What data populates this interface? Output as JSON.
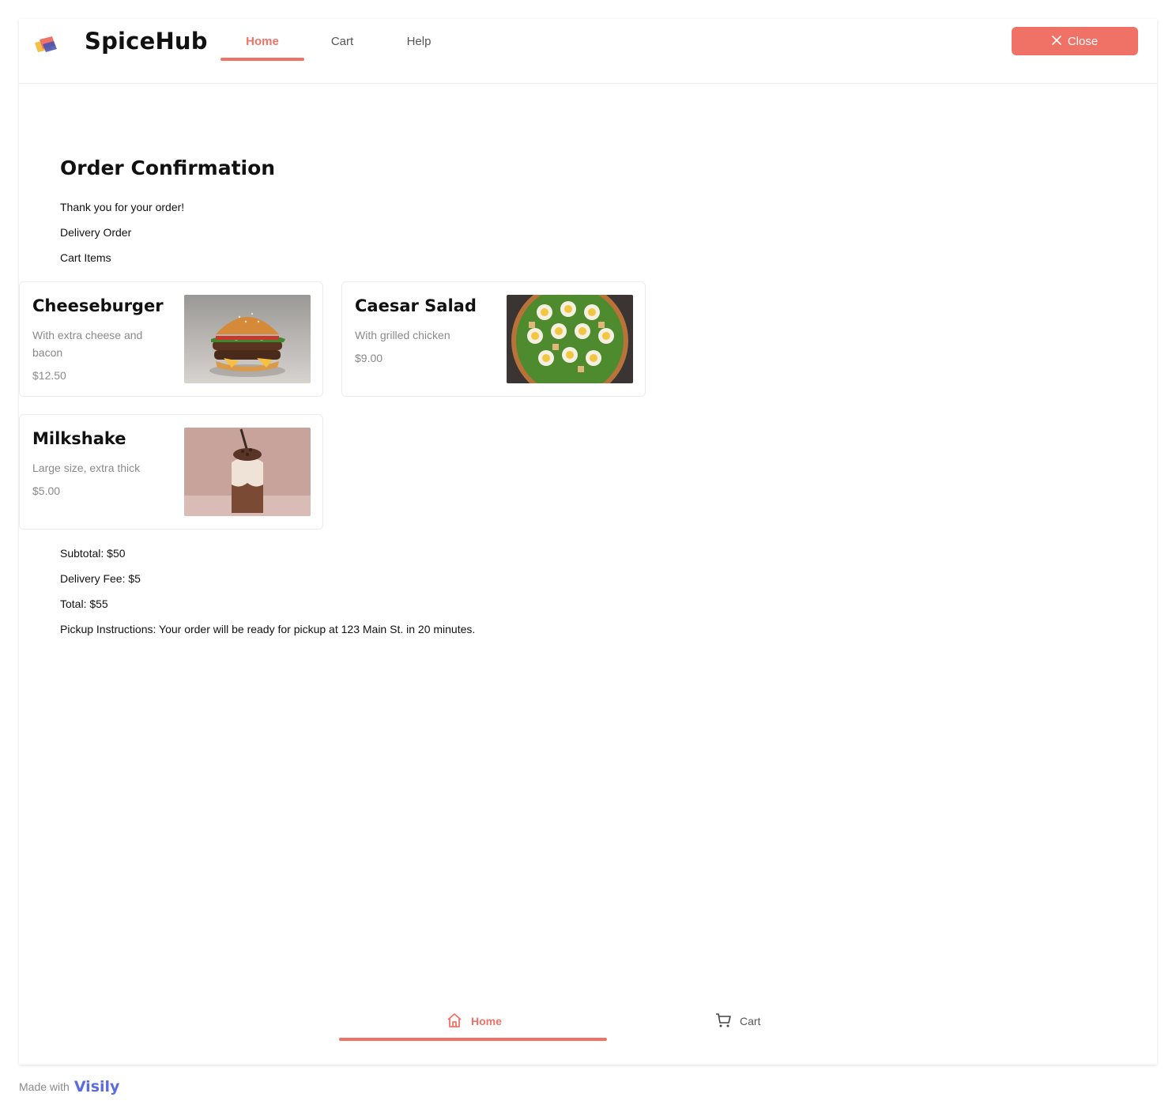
{
  "header": {
    "brand": "SpiceHub",
    "tabs": [
      {
        "label": "Home"
      },
      {
        "label": "Cart"
      },
      {
        "label": "Help"
      }
    ],
    "close_label": "Close"
  },
  "main": {
    "title": "Order Confirmation",
    "thanks": "Thank you for your order!",
    "order_type": "Delivery Order",
    "cart_heading": "Cart Items",
    "items": [
      {
        "name": "Cheeseburger",
        "description": "With extra cheese and bacon",
        "price": "$12.50"
      },
      {
        "name": "Caesar Salad",
        "description": "With grilled chicken",
        "price": "$9.00"
      },
      {
        "name": "Milkshake",
        "description": "Large size, extra thick",
        "price": "$5.00"
      }
    ],
    "subtotal": "Subtotal: $50",
    "delivery_fee": "Delivery Fee: $5",
    "total": "Total: $55",
    "pickup_instructions": "Pickup Instructions: Your order will be ready for pickup at 123 Main St. in 20 minutes."
  },
  "bottom_nav": {
    "items": [
      {
        "label": "Home",
        "icon": "home-icon"
      },
      {
        "label": "Cart",
        "icon": "cart-icon"
      }
    ]
  },
  "footer": {
    "made_with": "Made with",
    "brand": "Visily"
  },
  "colors": {
    "accent": "#f07266",
    "text": "#111111",
    "muted": "#8a8a8a"
  }
}
